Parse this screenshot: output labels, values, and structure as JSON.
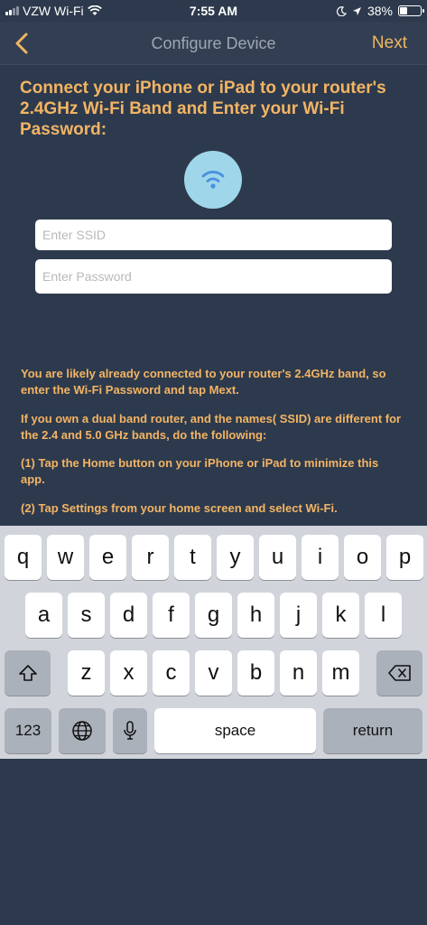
{
  "status_bar": {
    "carrier": "VZW Wi-Fi",
    "time": "7:55 AM",
    "battery_percent": "38%",
    "battery_level": 0.38
  },
  "nav": {
    "title": "Configure Device",
    "next_label": "Next"
  },
  "heading": "Connect your iPhone or iPad to your router's 2.4GHz Wi-Fi Band and Enter your Wi-Fi Password:",
  "form": {
    "ssid_placeholder": "Enter SSID",
    "ssid_value": "",
    "password_placeholder": "Enter Password",
    "password_value": ""
  },
  "instructions": [
    "You are likely already connected to your router's 2.4GHz band, so enter the Wi-Fi Password and tap Mext.",
    "If you own a dual band router, and the names( SSID) are different for the 2.4 and 5.0 GHz bands, do the following:",
    "(1) Tap the Home button on your iPhone or iPad to minimize this app.",
    "(2) Tap Settings from your home screen and select Wi-Fi."
  ],
  "keyboard": {
    "row1": [
      "q",
      "w",
      "e",
      "r",
      "t",
      "y",
      "u",
      "i",
      "o",
      "p"
    ],
    "row2": [
      "a",
      "s",
      "d",
      "f",
      "g",
      "h",
      "j",
      "k",
      "l"
    ],
    "row3": [
      "z",
      "x",
      "c",
      "v",
      "b",
      "n",
      "m"
    ],
    "numbers_label": "123",
    "space_label": "space",
    "return_label": "return"
  },
  "colors": {
    "background": "#2d3a4d",
    "accent": "#f3b464",
    "wifi_circle": "#9fd6ea",
    "wifi_icon": "#4a90e2"
  }
}
